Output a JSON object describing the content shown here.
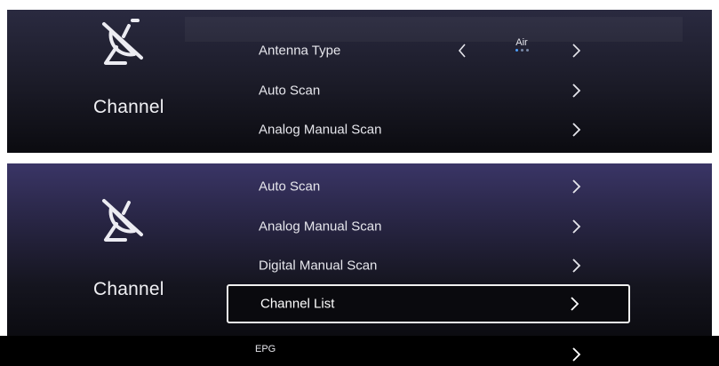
{
  "top_panel": {
    "category": {
      "icon": "satellite-dish-off-icon",
      "label": "Channel"
    },
    "items": [
      {
        "label": "Antenna Type",
        "value": "Air",
        "value_option_count": 3,
        "value_option_index": 0
      },
      {
        "label": "Auto Scan"
      },
      {
        "label": "Analog Manual Scan"
      }
    ]
  },
  "bottom_panel": {
    "category": {
      "icon": "satellite-dish-off-icon",
      "label": "Channel"
    },
    "items": [
      {
        "label": "Auto Scan"
      },
      {
        "label": "Analog Manual Scan"
      },
      {
        "label": "Digital Manual Scan"
      },
      {
        "label": "Channel List",
        "selected": true
      },
      {
        "label": "EPG"
      }
    ]
  },
  "colors": {
    "selected_border": "#f0f0f0",
    "dot_active": "#4ea0ff",
    "dot_inactive": "#7a8aa8"
  }
}
